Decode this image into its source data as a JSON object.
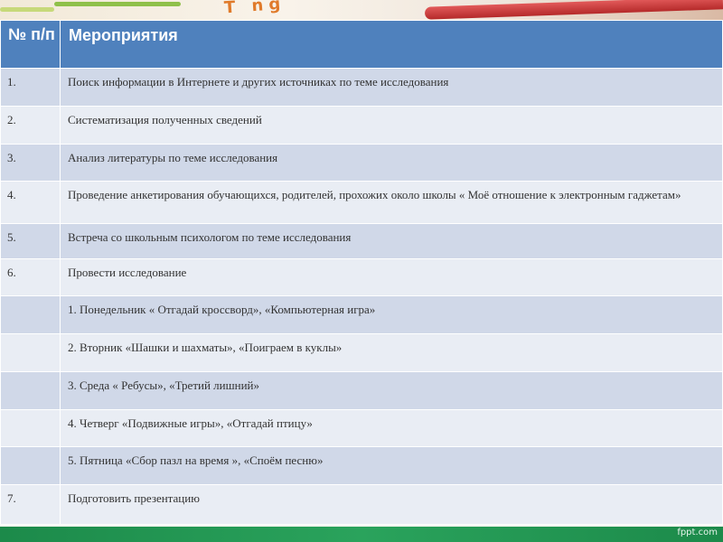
{
  "header": {
    "col_num": "№ п/п",
    "col_events": "Мероприятия"
  },
  "rows": [
    {
      "num": "1.",
      "text": "Поиск информации в Интернете и других источниках по теме исследования"
    },
    {
      "num": "2.",
      "text": "Систематизация  полученных сведений"
    },
    {
      "num": "3.",
      "text": "Анализ литературы по теме исследования"
    },
    {
      "num": "4.",
      "text": "Проведение анкетирования  обучающихся, родителей, прохожих около школы « Моё отношение к электронным гаджетам»"
    },
    {
      "num": "5.",
      "text": "Встреча со школьным  психологом по теме исследования"
    },
    {
      "num": "6.",
      "text": "Провести исследование"
    },
    {
      "num": "",
      "text": "1.  Понедельник « Отгадай кроссворд», «Компьютерная игра»"
    },
    {
      "num": "",
      "text": "2.  Вторник «Шашки и шахматы», «Поиграем в куклы»"
    },
    {
      "num": "",
      "text": "3.  Среда « Ребусы», «Третий лишний»"
    },
    {
      "num": "",
      "text": "4.  Четверг «Подвижные игры», «Отгадай птицу»"
    },
    {
      "num": "",
      "text": "5.  Пятница «Сбор пазл на время », «Споём песню»"
    },
    {
      "num": "7.",
      "text": "Подготовить презентацию"
    }
  ],
  "footer": {
    "brand": "fppt.com"
  },
  "banner": {
    "letters": "T ng"
  },
  "colors": {
    "header_bg": "#4f81bd",
    "row_odd": "#d0d8e8",
    "row_even": "#e9edf4",
    "footer_bg": "#2aa35c"
  }
}
